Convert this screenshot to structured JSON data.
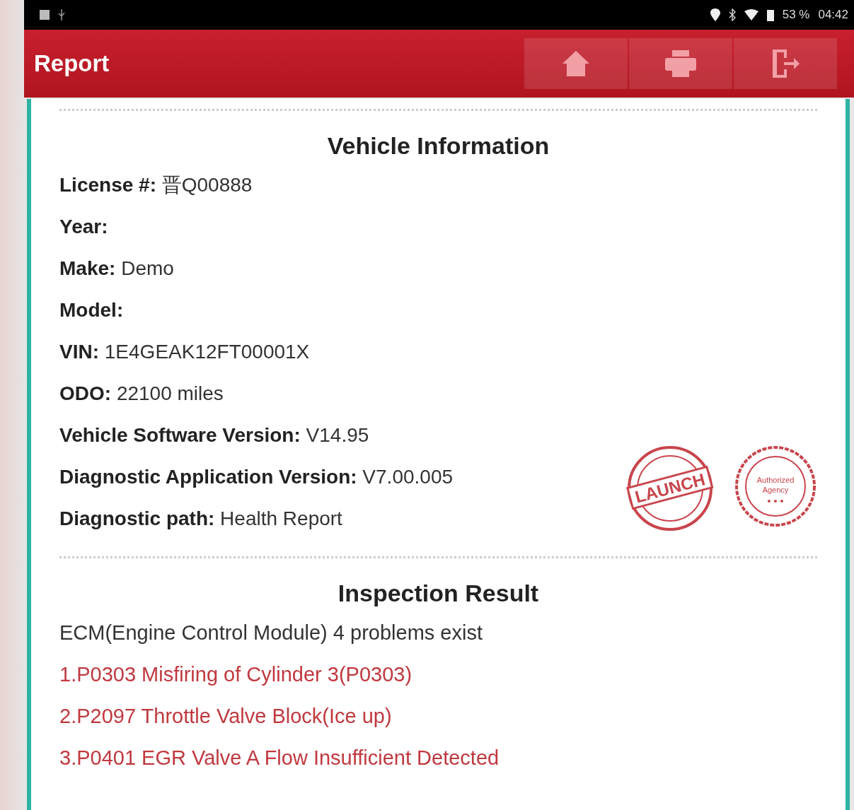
{
  "status_bar": {
    "battery": "53 %",
    "time": "04:42"
  },
  "header": {
    "title": "Report",
    "buttons": [
      {
        "kind": "home"
      },
      {
        "kind": "print"
      },
      {
        "kind": "exit"
      }
    ]
  },
  "vehicle_information": {
    "title": "Vehicle Information",
    "rows": [
      "**License #:** 晋Q00888",
      "**Year:**",
      "**Make:** Demo",
      "**Model:**",
      "**VIN:** 1E4GEAK12FT00001X",
      "**ODO:** 22100 miles",
      "**Vehicle Software Version:** V14.95",
      "**Diagnostic Application Version:** V7.00.005",
      "**Diagnostic path:** Health Report"
    ],
    "stamps": [
      {
        "kind": "brand",
        "text": "LAUNCH"
      },
      {
        "kind": "agency",
        "text": "Authorized Agency"
      }
    ]
  },
  "inspection_result": {
    "title": "Inspection Result",
    "summary": "ECM(Engine Control Module) 4 problems exist",
    "problems": [
      "1.P0303 Misfiring of Cylinder 3(P0303)",
      "2.P2097 Throttle Valve Block(Ice up)",
      "3.P0401 EGR Valve A Flow Insufficient Detected"
    ]
  }
}
